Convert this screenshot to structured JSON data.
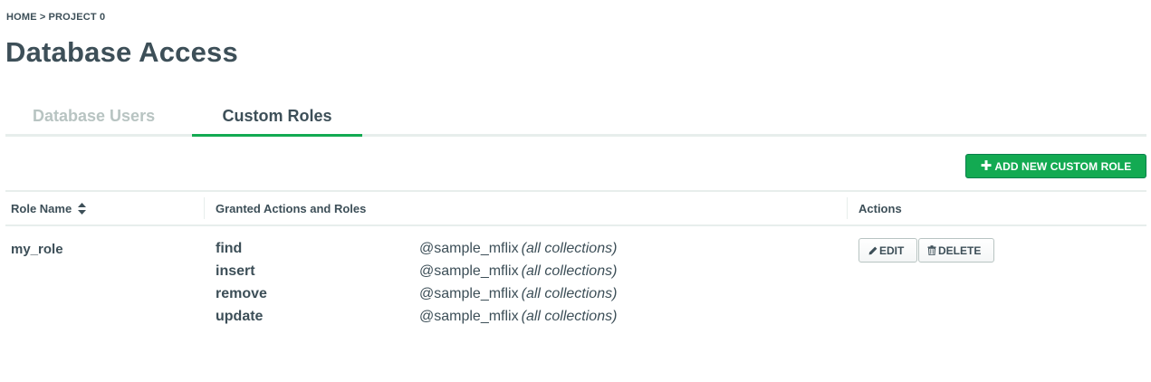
{
  "breadcrumb": {
    "home": "HOME",
    "separator": ">",
    "project": "PROJECT 0"
  },
  "page": {
    "title": "Database Access"
  },
  "tabs": [
    {
      "label": "Database Users",
      "active": false
    },
    {
      "label": "Custom Roles",
      "active": true
    }
  ],
  "toolbar": {
    "add_label": "ADD NEW CUSTOM ROLE",
    "add_icon": "plus-icon"
  },
  "table": {
    "headers": {
      "name": "Role Name",
      "granted": "Granted Actions and Roles",
      "actions": "Actions"
    },
    "rows": [
      {
        "name": "my_role",
        "grants": [
          {
            "action": "find",
            "db": "@sample_mflix",
            "scope": "(all collections)"
          },
          {
            "action": "insert",
            "db": "@sample_mflix",
            "scope": "(all collections)"
          },
          {
            "action": "remove",
            "db": "@sample_mflix",
            "scope": "(all collections)"
          },
          {
            "action": "update",
            "db": "@sample_mflix",
            "scope": "(all collections)"
          }
        ],
        "edit_label": "EDIT",
        "delete_label": "DELETE"
      }
    ]
  },
  "colors": {
    "accent": "#13aa52",
    "text": "#3d4f58",
    "muted": "#b8c4c2",
    "border": "#e7eeec"
  }
}
